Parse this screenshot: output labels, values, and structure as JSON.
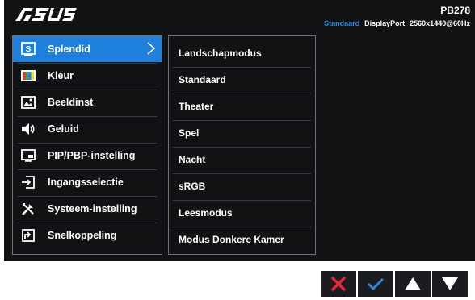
{
  "header": {
    "brand": "ASUS",
    "model": "PB278",
    "status": {
      "mode": "Standaard",
      "input": "DisplayPort",
      "resolution": "2560x1440@60Hz"
    }
  },
  "main_menu": [
    {
      "label": "Splendid",
      "icon": "splendid-icon",
      "selected": true
    },
    {
      "label": "Kleur",
      "icon": "color-icon"
    },
    {
      "label": "Beeldinst",
      "icon": "image-icon"
    },
    {
      "label": "Geluid",
      "icon": "speaker-icon"
    },
    {
      "label": "PIP/PBP-instelling",
      "icon": "pip-icon"
    },
    {
      "label": "Ingangsselectie",
      "icon": "input-select-icon"
    },
    {
      "label": "Systeem-instelling",
      "icon": "tools-icon"
    },
    {
      "label": "Snelkoppeling",
      "icon": "shortcut-icon"
    }
  ],
  "sub_menu": [
    {
      "label": "Landschapmodus"
    },
    {
      "label": "Standaard"
    },
    {
      "label": "Theater"
    },
    {
      "label": "Spel"
    },
    {
      "label": "Nacht"
    },
    {
      "label": "sRGB"
    },
    {
      "label": "Leesmodus"
    },
    {
      "label": "Modus Donkere Kamer"
    }
  ],
  "keys": [
    {
      "icon": "close-icon",
      "color": "#e8283a"
    },
    {
      "icon": "check-icon",
      "color": "#2f86d8"
    },
    {
      "icon": "up-arrow-icon",
      "color": "#ffffff"
    },
    {
      "icon": "down-arrow-icon",
      "color": "#ffffff"
    }
  ],
  "colors": {
    "accent": "#1e7fdc",
    "osd_background": "#111214",
    "border": "#6f7378"
  }
}
